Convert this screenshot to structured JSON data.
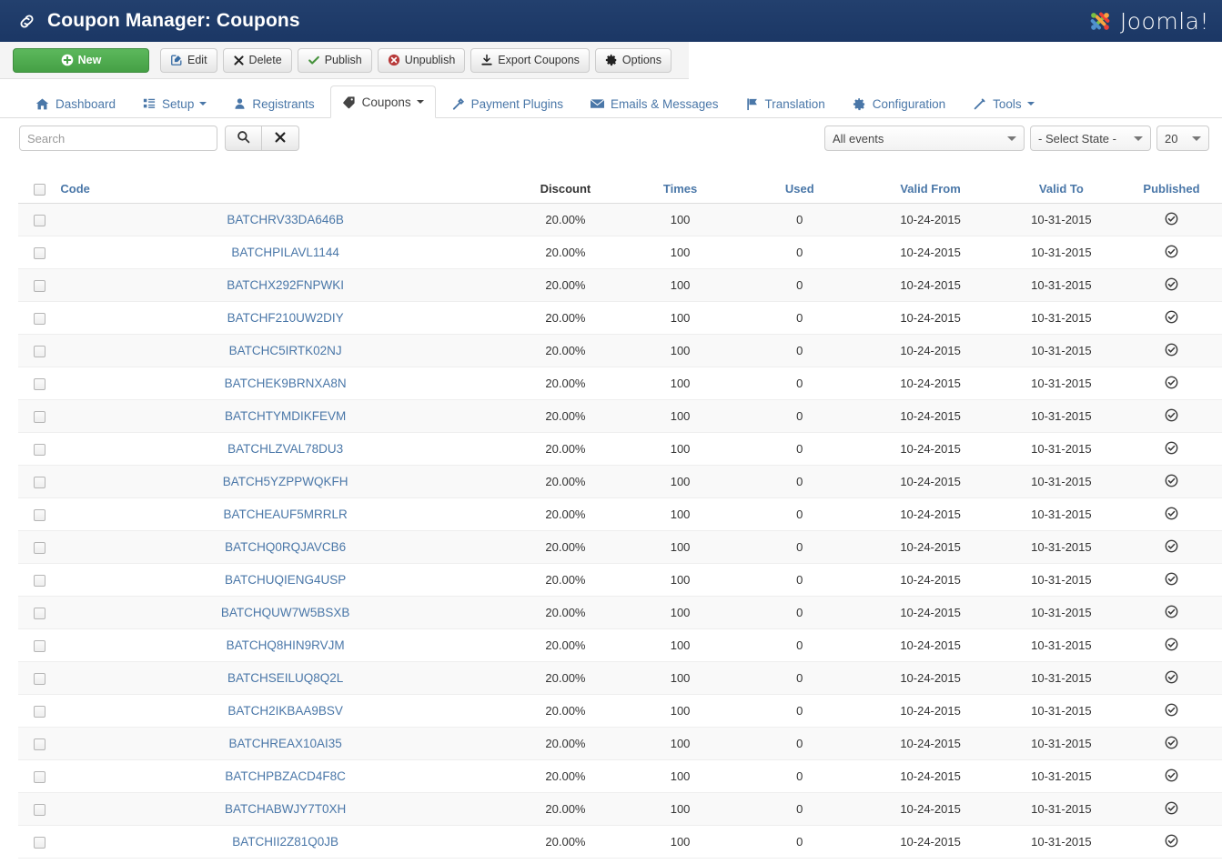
{
  "header": {
    "title": "Coupon Manager: Coupons",
    "link_icon": "chain-link-icon",
    "brand": "Joomla!"
  },
  "toolbar": {
    "buttons": [
      {
        "label": "New",
        "icon": "plus-circle-icon",
        "style": "primary"
      },
      {
        "label": "Edit",
        "icon": "pencil-square-icon",
        "style": "default"
      },
      {
        "label": "Delete",
        "icon": "x-mark-icon",
        "style": "default"
      },
      {
        "label": "Publish",
        "icon": "check-icon",
        "style": "default"
      },
      {
        "label": "Unpublish",
        "icon": "x-circle-icon",
        "style": "default"
      },
      {
        "label": "Export Coupons",
        "icon": "download-icon",
        "style": "default"
      },
      {
        "label": "Options",
        "icon": "gear-icon",
        "style": "default"
      }
    ]
  },
  "nav": {
    "tabs": [
      {
        "label": "Dashboard",
        "icon": "home-icon",
        "active": false,
        "caret": false
      },
      {
        "label": "Setup",
        "icon": "list-icon",
        "active": false,
        "caret": true
      },
      {
        "label": "Registrants",
        "icon": "user-icon",
        "active": false,
        "caret": false
      },
      {
        "label": "Coupons",
        "icon": "tag-icon",
        "active": true,
        "caret": true
      },
      {
        "label": "Payment Plugins",
        "icon": "wrench-icon",
        "active": false,
        "caret": false
      },
      {
        "label": "Emails & Messages",
        "icon": "envelope-icon",
        "active": false,
        "caret": false
      },
      {
        "label": "Translation",
        "icon": "flag-icon",
        "active": false,
        "caret": false
      },
      {
        "label": "Configuration",
        "icon": "gear-icon",
        "active": false,
        "caret": false
      },
      {
        "label": "Tools",
        "icon": "pencil-icon",
        "active": false,
        "caret": true
      }
    ]
  },
  "filters": {
    "search_placeholder": "Search",
    "search_value": "",
    "search_button_icon": "search-icon",
    "clear_button_icon": "x-mark-icon",
    "event_select": "All events",
    "state_select": "- Select State -",
    "limit_select": "20"
  },
  "table": {
    "columns": [
      {
        "key": "code",
        "label": "Code",
        "sortable": true
      },
      {
        "key": "discount",
        "label": "Discount",
        "sortable": false
      },
      {
        "key": "times",
        "label": "Times",
        "sortable": true
      },
      {
        "key": "used",
        "label": "Used",
        "sortable": true
      },
      {
        "key": "valid_from",
        "label": "Valid From",
        "sortable": true
      },
      {
        "key": "valid_to",
        "label": "Valid To",
        "sortable": true
      },
      {
        "key": "published",
        "label": "Published",
        "sortable": true
      }
    ],
    "published_icon": "published-check-circle-icon",
    "rows": [
      {
        "code": "BATCHRV33DA646B",
        "discount": "20.00%",
        "times": "100",
        "used": "0",
        "valid_from": "10-24-2015",
        "valid_to": "10-31-2015",
        "published": true
      },
      {
        "code": "BATCHPILAVL1144",
        "discount": "20.00%",
        "times": "100",
        "used": "0",
        "valid_from": "10-24-2015",
        "valid_to": "10-31-2015",
        "published": true
      },
      {
        "code": "BATCHX292FNPWKI",
        "discount": "20.00%",
        "times": "100",
        "used": "0",
        "valid_from": "10-24-2015",
        "valid_to": "10-31-2015",
        "published": true
      },
      {
        "code": "BATCHF210UW2DIY",
        "discount": "20.00%",
        "times": "100",
        "used": "0",
        "valid_from": "10-24-2015",
        "valid_to": "10-31-2015",
        "published": true
      },
      {
        "code": "BATCHC5IRTK02NJ",
        "discount": "20.00%",
        "times": "100",
        "used": "0",
        "valid_from": "10-24-2015",
        "valid_to": "10-31-2015",
        "published": true
      },
      {
        "code": "BATCHEK9BRNXA8N",
        "discount": "20.00%",
        "times": "100",
        "used": "0",
        "valid_from": "10-24-2015",
        "valid_to": "10-31-2015",
        "published": true
      },
      {
        "code": "BATCHTYMDIKFEVM",
        "discount": "20.00%",
        "times": "100",
        "used": "0",
        "valid_from": "10-24-2015",
        "valid_to": "10-31-2015",
        "published": true
      },
      {
        "code": "BATCHLZVAL78DU3",
        "discount": "20.00%",
        "times": "100",
        "used": "0",
        "valid_from": "10-24-2015",
        "valid_to": "10-31-2015",
        "published": true
      },
      {
        "code": "BATCH5YZPPWQKFH",
        "discount": "20.00%",
        "times": "100",
        "used": "0",
        "valid_from": "10-24-2015",
        "valid_to": "10-31-2015",
        "published": true
      },
      {
        "code": "BATCHEAUF5MRRLR",
        "discount": "20.00%",
        "times": "100",
        "used": "0",
        "valid_from": "10-24-2015",
        "valid_to": "10-31-2015",
        "published": true
      },
      {
        "code": "BATCHQ0RQJAVCB6",
        "discount": "20.00%",
        "times": "100",
        "used": "0",
        "valid_from": "10-24-2015",
        "valid_to": "10-31-2015",
        "published": true
      },
      {
        "code": "BATCHUQIENG4USP",
        "discount": "20.00%",
        "times": "100",
        "used": "0",
        "valid_from": "10-24-2015",
        "valid_to": "10-31-2015",
        "published": true
      },
      {
        "code": "BATCHQUW7W5BSXB",
        "discount": "20.00%",
        "times": "100",
        "used": "0",
        "valid_from": "10-24-2015",
        "valid_to": "10-31-2015",
        "published": true
      },
      {
        "code": "BATCHQ8HIN9RVJM",
        "discount": "20.00%",
        "times": "100",
        "used": "0",
        "valid_from": "10-24-2015",
        "valid_to": "10-31-2015",
        "published": true
      },
      {
        "code": "BATCHSEILUQ8Q2L",
        "discount": "20.00%",
        "times": "100",
        "used": "0",
        "valid_from": "10-24-2015",
        "valid_to": "10-31-2015",
        "published": true
      },
      {
        "code": "BATCH2IKBAA9BSV",
        "discount": "20.00%",
        "times": "100",
        "used": "0",
        "valid_from": "10-24-2015",
        "valid_to": "10-31-2015",
        "published": true
      },
      {
        "code": "BATCHREAX10AI35",
        "discount": "20.00%",
        "times": "100",
        "used": "0",
        "valid_from": "10-24-2015",
        "valid_to": "10-31-2015",
        "published": true
      },
      {
        "code": "BATCHPBZACD4F8C",
        "discount": "20.00%",
        "times": "100",
        "used": "0",
        "valid_from": "10-24-2015",
        "valid_to": "10-31-2015",
        "published": true
      },
      {
        "code": "BATCHABWJY7T0XH",
        "discount": "20.00%",
        "times": "100",
        "used": "0",
        "valid_from": "10-24-2015",
        "valid_to": "10-31-2015",
        "published": true
      },
      {
        "code": "BATCHII2Z81Q0JB",
        "discount": "20.00%",
        "times": "100",
        "used": "0",
        "valid_from": "10-24-2015",
        "valid_to": "10-31-2015",
        "published": true
      }
    ],
    "seam_after_row_index": 11
  },
  "colors": {
    "header_bg": "#1c3d6e",
    "link_blue": "#4a77a8",
    "new_green": "#45a045",
    "unpublish_red": "#b83b3b",
    "toolbar_bg": "#f4f4f4"
  }
}
